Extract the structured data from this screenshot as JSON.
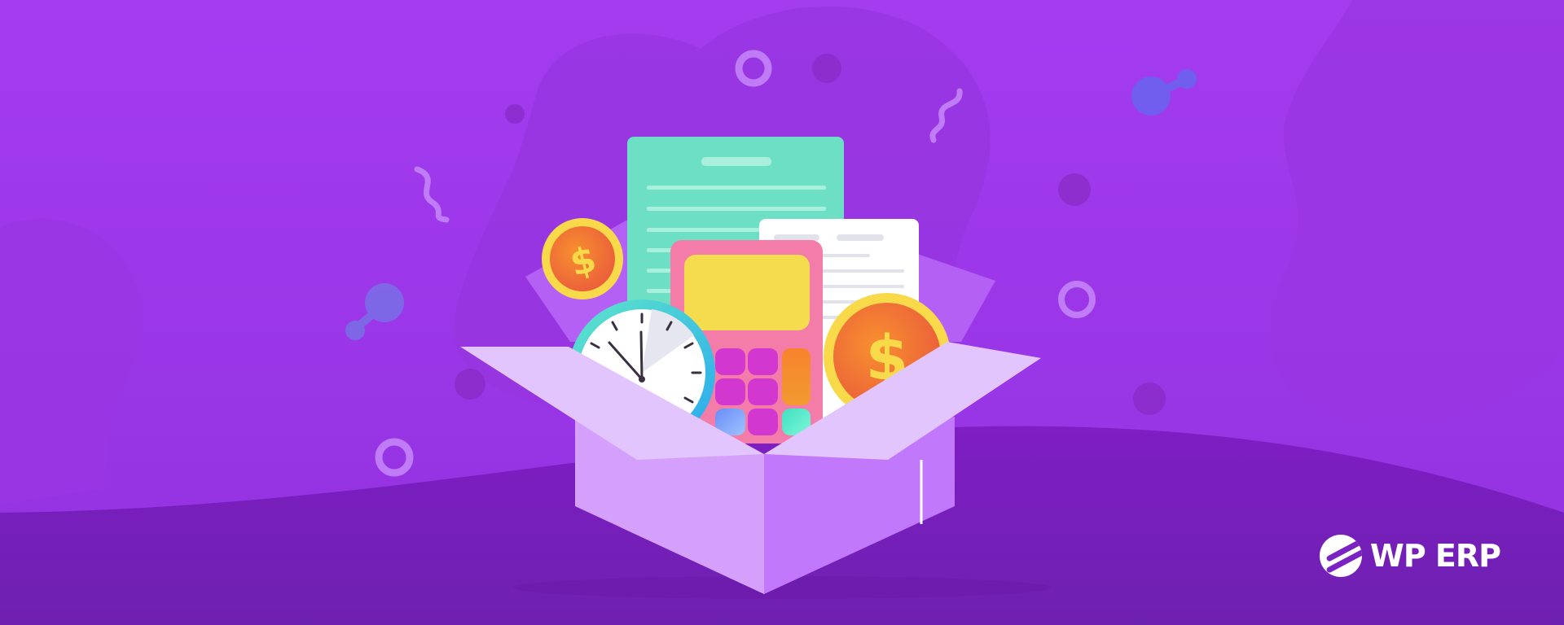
{
  "brand": {
    "logo_text": "WP ERP",
    "icon": "wp-erp-logo-icon"
  },
  "illustration": {
    "subject": "open-box-with-accounting-items",
    "items": [
      "green-document",
      "white-document",
      "calculator",
      "clock",
      "dollar-coin-large",
      "dollar-coin-small"
    ],
    "coin_symbol": "$"
  },
  "colors": {
    "background_top": "#a040ec",
    "background_bottom": "#7420b8",
    "box": "#c98cfb",
    "accent_yellow": "#f7d949",
    "accent_orange": "#f7832c"
  }
}
